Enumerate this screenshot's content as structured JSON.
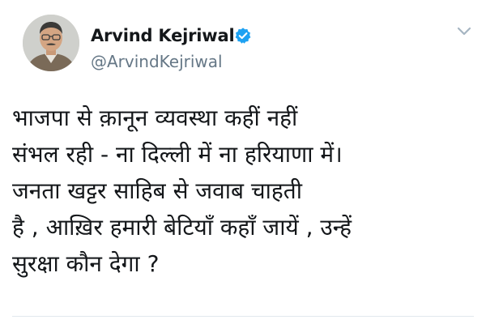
{
  "author": {
    "name": "Arvind Kejriwal",
    "handle": "@ArvindKejriwal",
    "verified": true,
    "verified_icon": "verified-badge-icon",
    "avatar_icon": "profile-photo"
  },
  "tweet": {
    "lines": [
      "भाजपा से क़ानून व्यवस्था कहीं नहीं",
      "संभल रही - ना दिल्ली में ना हरियाणा में।",
      "जनता खट्टर साहिब से जवाब चाहती",
      "है , आख़िर हमारी बेटियाँ कहाँ जायें , उन्हें",
      "सुरक्षा कौन देगा ?"
    ]
  },
  "menu": {
    "icon": "chevron-down-icon"
  },
  "colors": {
    "verified_blue": "#1da1f2",
    "handle_gray": "#657786",
    "text": "#14171a",
    "caret": "#a6b5c2"
  }
}
